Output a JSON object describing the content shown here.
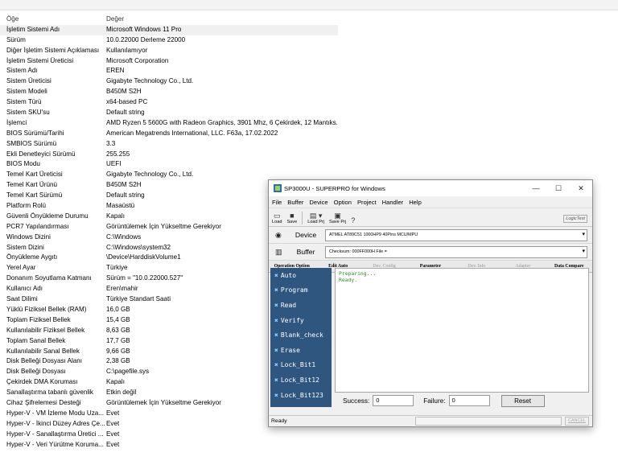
{
  "sysinfo": {
    "header": {
      "item": "Öğe",
      "value": "Değer"
    },
    "rows": [
      {
        "item": "İşletim Sistemi Adı",
        "value": "Microsoft Windows 11 Pro"
      },
      {
        "item": "Sürüm",
        "value": "10.0.22000 Derleme 22000"
      },
      {
        "item": "Diğer İşletim Sistemi Açıklaması",
        "value": "Kullanılamıyor"
      },
      {
        "item": "İşletim Sistemi Üreticisi",
        "value": "Microsoft Corporation"
      },
      {
        "item": "Sistem Adı",
        "value": "EREN"
      },
      {
        "item": "Sistem Üreticisi",
        "value": "Gigabyte Technology Co., Ltd."
      },
      {
        "item": "Sistem Modeli",
        "value": "B450M S2H"
      },
      {
        "item": "Sistem Türü",
        "value": "x64-based PC"
      },
      {
        "item": "Sistem SKU'su",
        "value": "Default string"
      },
      {
        "item": "İşlemci",
        "value": "AMD Ryzen 5 5600G with Radeon Graphics, 3901 Mhz, 6 Çekirdek, 12 Mantıks..."
      },
      {
        "item": "BIOS Sürümü/Tarihi",
        "value": "American Megatrends International, LLC. F63a, 17.02.2022"
      },
      {
        "item": "SMBIOS Sürümü",
        "value": "3.3"
      },
      {
        "item": "Ekli Denetleyici Sürümü",
        "value": "255.255"
      },
      {
        "item": "BIOS Modu",
        "value": "UEFI"
      },
      {
        "item": "Temel Kart Üreticisi",
        "value": "Gigabyte Technology Co., Ltd."
      },
      {
        "item": "Temel Kart Ürünü",
        "value": "B450M S2H"
      },
      {
        "item": "Temel Kart Sürümü",
        "value": "Default string"
      },
      {
        "item": "Platform Rolü",
        "value": "Masaüstü"
      },
      {
        "item": "Güvenli Önyükleme Durumu",
        "value": "Kapalı"
      },
      {
        "item": "PCR7 Yapılandırması",
        "value": "Görüntülemek İçin Yükseltme Gerekiyor"
      },
      {
        "item": "Windows Dizini",
        "value": "C:\\Windows"
      },
      {
        "item": "Sistem Dizini",
        "value": "C:\\Windows\\system32"
      },
      {
        "item": "Önyükleme Aygıtı",
        "value": "\\Device\\HarddiskVolume1"
      },
      {
        "item": "Yerel Ayar",
        "value": "Türkiye"
      },
      {
        "item": "Donanım Soyutlama Katmanı",
        "value": "Sürüm = \"10.0.22000.527\""
      },
      {
        "item": "Kullanıcı Adı",
        "value": "Eren\\mahir"
      },
      {
        "item": "Saat Dilimi",
        "value": "Türkiye Standart Saati"
      },
      {
        "item": "Yüklü Fiziksel Bellek (RAM)",
        "value": "16,0 GB"
      },
      {
        "item": "Toplam Fiziksel Bellek",
        "value": "15,4 GB"
      },
      {
        "item": "Kullanılabilir Fiziksel Bellek",
        "value": "8,63 GB"
      },
      {
        "item": "Toplam Sanal Bellek",
        "value": "17,7 GB"
      },
      {
        "item": "Kullanılabilir Sanal Bellek",
        "value": "9,66 GB"
      },
      {
        "item": "Disk Belleği Dosyası Alanı",
        "value": "2,38 GB"
      },
      {
        "item": "Disk Belleği Dosyası",
        "value": "C:\\pagefile.sys"
      },
      {
        "item": "Çekirdek DMA Koruması",
        "value": "Kapalı"
      },
      {
        "item": "Sanallaştırma tabanlı güvenlik",
        "value": "Etkin değil"
      },
      {
        "item": "Cihaz Şifrelemesi Desteği",
        "value": "Görüntülemek İçin Yükseltme Gerekiyor"
      },
      {
        "item": "Hyper-V - VM İzleme Modu Uza...",
        "value": "Evet"
      },
      {
        "item": "Hyper-V - İkinci Düzey Adres Çe...",
        "value": "Evet"
      },
      {
        "item": "Hyper-V - Sanallaştırma Üretici ...",
        "value": "Evet"
      },
      {
        "item": "Hyper-V - Veri Yürütme Koruma...",
        "value": "Evet"
      }
    ]
  },
  "programmer": {
    "title": "SP3000U - SUPERPRO for Windows",
    "window_buttons": {
      "minimize": "—",
      "maximize": "☐",
      "close": "✕"
    },
    "menu": [
      "File",
      "Buffer",
      "Device",
      "Option",
      "Project",
      "Handler",
      "Help"
    ],
    "toolbar": {
      "load": "Load",
      "save": "Save",
      "load_prj": "Load Prj",
      "save_prj": "Save Prj",
      "logo": "LogicTest"
    },
    "device_label": "Device",
    "device_value": "ATMEL  AT89C51  1000HP9  40Pins  MCU/MPU",
    "buffer_label": "Buffer",
    "buffer_value": "Checksum: 000FF000H   File =",
    "tabs": [
      "Operation Option",
      "Edit Auto",
      "Dev. Config",
      "Parameter",
      "Dev. Info",
      "Adapter",
      "Data Compare"
    ],
    "operations": [
      "Auto",
      "Program",
      "Read",
      "Verify",
      "Blank_check",
      "Erase",
      "Lock_Bit1",
      "Lock_Bit12",
      "Lock_Bit123"
    ],
    "console_lines": [
      "Preparing...",
      "Ready."
    ],
    "success_label": "Success:",
    "success_value": "0",
    "failure_label": "Failure:",
    "failure_value": "0",
    "reset_label": "Reset",
    "status_text": "Ready",
    "cancel_label": "CANCEL",
    "colors": {
      "left_panel": "#2f567f",
      "console_text": "#2e8b2e"
    }
  }
}
